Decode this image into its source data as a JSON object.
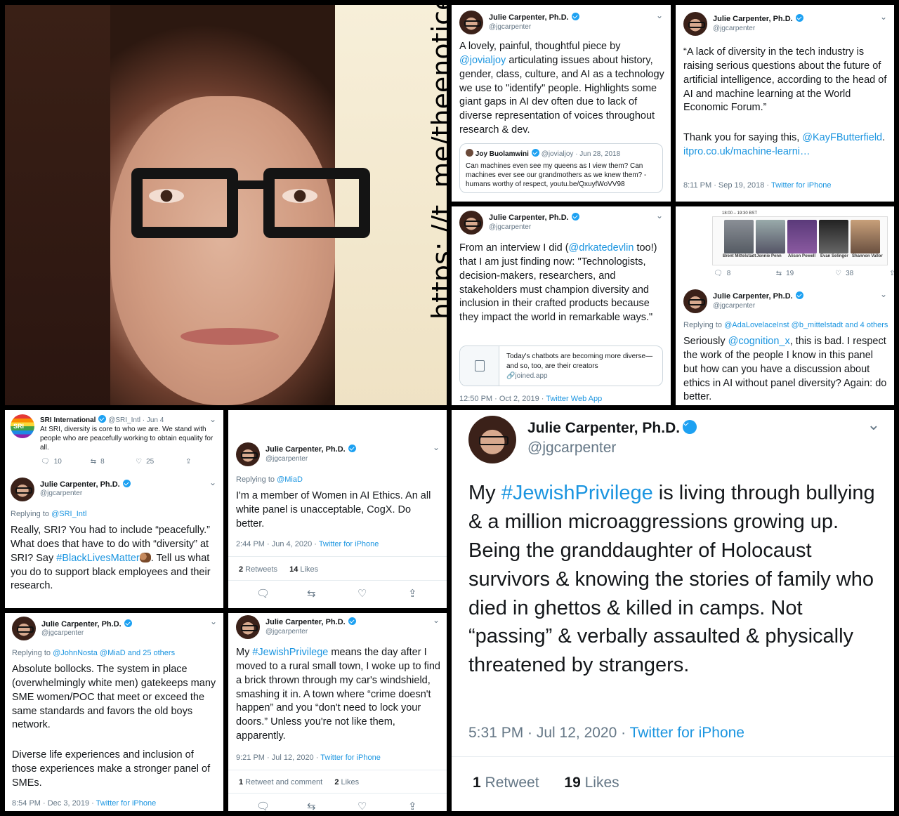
{
  "watermark": "https: //t. me/theenoticer",
  "user": {
    "name": "Julie Carpenter, Ph.D.",
    "handle": "@jgcarpenter"
  },
  "t1": {
    "body_a": "A lovely, painful, thoughtful piece by ",
    "mention": "@jovialjoy",
    "body_b": " articulating issues about history, gender, class, culture, and AI as a technology we use to \"identify\" people. Highlights some giant gaps in AI dev often due to lack of diverse representation of voices throughout research & dev.",
    "quote": {
      "name": "Joy Buolamwini",
      "handle_date": "@jovialjoy · Jun 28, 2018",
      "text": "Can machines even see my queens as I view them? Can machines ever see our grandmothers as we knew them? - humans worthy of respect, youtu.be/QxuyfWoVV98"
    }
  },
  "t2": {
    "body": "“A lack of diversity in the tech industry is raising serious questions about the future of artificial intelligence, according to the head of AI and machine learning at the World Economic Forum.”",
    "thanks": "Thank you for saying this,",
    "mention": "@KayFButterfield",
    "link": "itpro.co.uk/machine-learni…",
    "time": "8:11 PM · Sep 19, 2018 · ",
    "source": "Twitter for iPhone"
  },
  "t3": {
    "body_a": "From an interview I did (",
    "mention": "@drkatedevlin",
    "body_b": " too!) that I am just finding now: \"Technologists, decision-makers, researchers, and stakeholders must champion diversity and inclusion in their crafted products because they impact the world in remarkable ways.\"",
    "card_text": "Today's chatbots are becoming more diverse—and so, too, are their creators",
    "card_link": "joined.app",
    "time": "12:50 PM · Oct 2, 2019 · ",
    "source": "Twitter Web App"
  },
  "t4": {
    "event_time": "18:00 – 19:30 BST",
    "speakers": [
      "Brent Mittelstadt",
      "Jonnie Penn",
      "Alison Powell",
      "Evan Selinger",
      "Shannon Vallor"
    ],
    "replies": "8",
    "retweets": "19",
    "likes": "38",
    "replying": "Replying to ",
    "replying_to": "@AdaLovelaceInst @b_mittelstadt and 4 others",
    "body_a": "Seriously ",
    "mention": "@cognition_x",
    "body_b": ", this is bad. I respect the work of the people I know in this panel but how can you have a discussion about ethics in AI without panel diversity? Again: do better."
  },
  "t5": {
    "sri_name": "SRI International",
    "sri_handle": "@SRI_Intl · Jun 4",
    "sri_text": "At SRI, diversity is core to who we are. We stand with people who are peacefully working to obtain equality for all.",
    "replies": "10",
    "retweets": "8",
    "likes": "25",
    "replying": "Replying to ",
    "replying_to": "@SRI_Intl",
    "body_a": "Really, SRI? You had to include “peacefully.” What does that have to do with “diversity” at SRI? Say ",
    "hashtag": "#BlackLivesMatter",
    "body_b": ". Tell us what you do to support black employees and their research."
  },
  "t6": {
    "replying": "Replying to ",
    "replying_to": "@MiaD",
    "body": "I'm a member of Women in AI Ethics. An all white panel is unacceptable, CogX. Do better.",
    "time": "2:44 PM · Jun 4, 2020 · ",
    "source": "Twitter for iPhone",
    "rt_count": "2",
    "rt_label": " Retweets",
    "like_count": "14",
    "like_label": " Likes"
  },
  "t7": {
    "replying": "Replying to ",
    "replying_to": "@JohnNosta @MiaD and 25 others",
    "body": "Absolute bollocks. The system in place (overwhelmingly white men) gatekeeps many SME women/POC that meet or exceed the same standards and favors the old boys network.",
    "body2": "Diverse life experiences and inclusion of those experiences make a stronger panel of SMEs.",
    "time": "8:54 PM · Dec 3, 2019 · ",
    "source": "Twitter for iPhone"
  },
  "t8": {
    "body_a": "My ",
    "hashtag": "#JewishPrivilege",
    "body_b": " means the day after I moved to a rural small town, I woke up to find a brick thrown through my car's windshield, smashing it in. A town where “crime doesn't happen” and you “don't need to lock your doors.” Unless you're not like them, apparently.",
    "time": "9:21 PM · Jul 12, 2020 · ",
    "source": "Twitter for iPhone",
    "rt_count": "1",
    "rt_label": " Retweet and comment",
    "like_count": "2",
    "like_label": " Likes"
  },
  "t9": {
    "body_a": "My ",
    "hashtag": "#JewishPrivilege",
    "body_b": " is living through bullying & a million microaggressions growing up. Being the granddaughter of Holocaust survivors & knowing the stories of family who died in ghettos & killed in camps. Not “passing” & verbally assaulted & physically threatened by strangers.",
    "time": "5:31 PM · Jul 12, 2020 · ",
    "source": "Twitter for iPhone",
    "rt_count": "1",
    "rt_label": " Retweet",
    "like_count": "19",
    "like_label": " Likes"
  },
  "colors": {
    "link": "#1b95e0",
    "verified": "#1da1f2",
    "muted": "#657786"
  }
}
